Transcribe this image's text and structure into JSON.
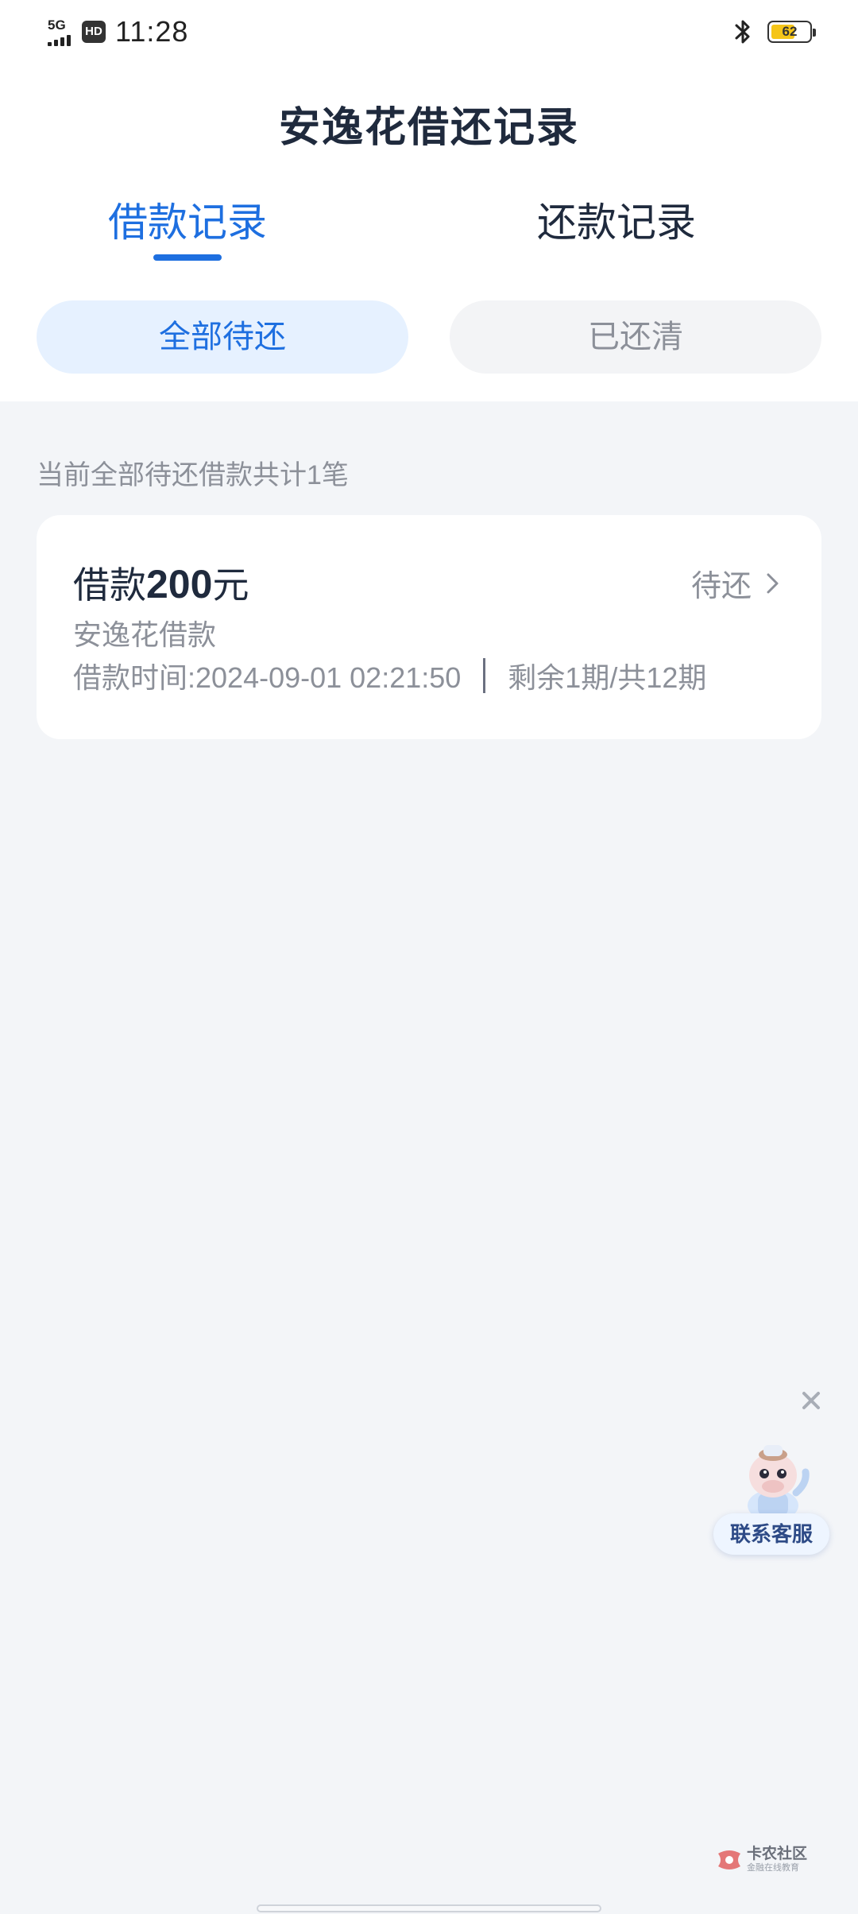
{
  "status_bar": {
    "network": "5G",
    "hd": "HD",
    "time": "11:28",
    "battery": "62",
    "battery_level": 0.62,
    "battery_color": "#f5c518"
  },
  "header": {
    "title": "安逸花借还记录"
  },
  "tabs": [
    {
      "label": "借款记录",
      "active": true
    },
    {
      "label": "还款记录",
      "active": false
    }
  ],
  "filters": [
    {
      "label": "全部待还",
      "selected": true
    },
    {
      "label": "已还清",
      "selected": false
    }
  ],
  "summary": "当前全部待还借款共计1笔",
  "loans": [
    {
      "amount_prefix": "借款",
      "amount": "200",
      "amount_unit": "元",
      "status": "待还",
      "product": "安逸花借款",
      "time": "借款时间:2024-09-01 02:21:50",
      "installments": "剩余1期/共12期"
    }
  ],
  "customer_service": {
    "label": "联系客服"
  },
  "watermark": {
    "title": "卡农社区",
    "subtitle": "金融在线教育"
  },
  "colors": {
    "accent": "#1e6fe0",
    "background": "#f3f5f8",
    "muted_text": "#8c9099",
    "primary_text": "#1f2a3d"
  },
  "icons": {
    "bluetooth": "bluetooth-icon",
    "chevron": "chevron-right-icon",
    "close": "close-icon",
    "mascot": "mascot-icon"
  }
}
